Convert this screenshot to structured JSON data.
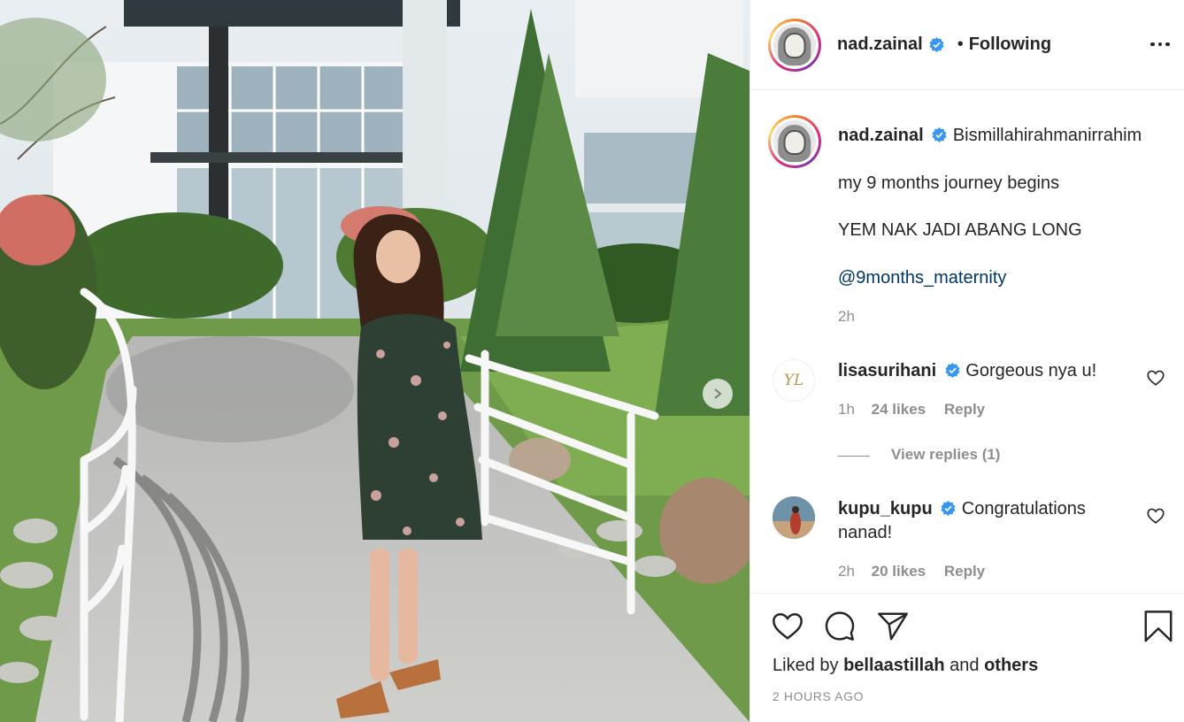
{
  "post": {
    "author": "nad.zainal",
    "separator": "•",
    "follow_status": "Following"
  },
  "caption": {
    "username": "nad.zainal",
    "line1": "Bismillahirahmanirrahim",
    "line2": "my 9 months journey begins",
    "line3": "YEM NAK JADI ABANG LONG",
    "mention": "@9months_maternity",
    "time": "2h"
  },
  "comments": [
    {
      "username": "lisasurihani",
      "text": "Gorgeous nya u!",
      "time": "1h",
      "likes": "24 likes",
      "reply_label": "Reply",
      "view_replies": "View replies (1)",
      "avatar_monogram": "YL"
    },
    {
      "username": "kupu_kupu",
      "text_line1": "Congratulations",
      "text_line2": "nanad!",
      "time": "2h",
      "likes": "20 likes",
      "reply_label": "Reply"
    }
  ],
  "footer": {
    "liked_prefix": "Liked by",
    "liked_user": "bellaastillah",
    "liked_and": "and",
    "liked_others": "others",
    "timestamp": "2 HOURS AGO"
  },
  "icons": {
    "verified": "verified-badge-icon",
    "like": "heart-icon",
    "comment": "comment-icon",
    "share": "paper-plane-icon",
    "save": "bookmark-icon",
    "more": "more-options-icon",
    "next": "chevron-right-icon"
  },
  "colors": {
    "verified": "#3897f0",
    "link": "#00376b",
    "secondary_text": "#8e8e8e",
    "text": "#262626"
  }
}
